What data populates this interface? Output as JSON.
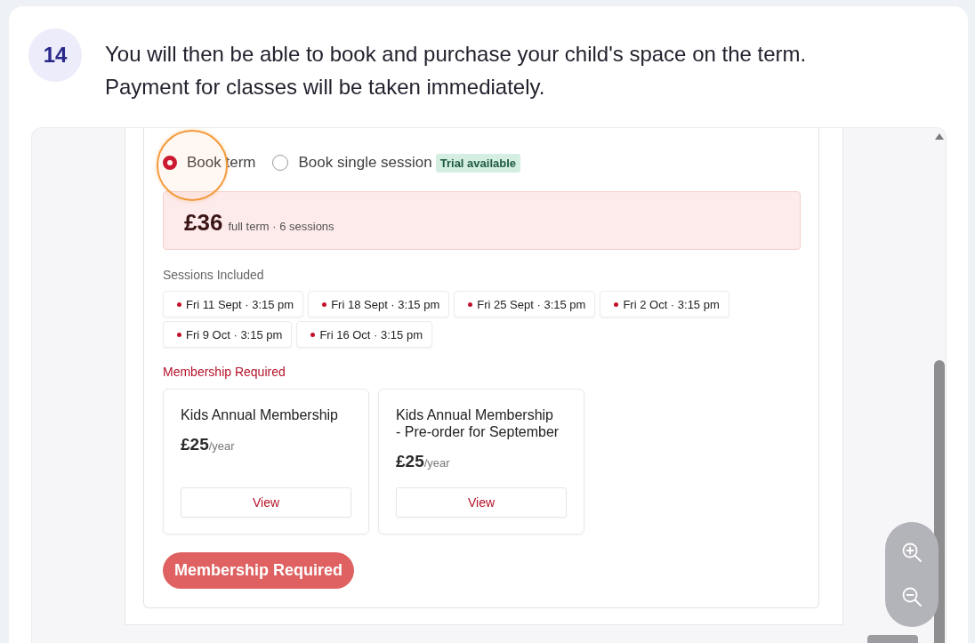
{
  "step": {
    "number": "14",
    "text": "You will then be able to book and purchase your child's space on the term. Payment for classes will be taken immediately."
  },
  "booking": {
    "options": [
      {
        "label": "Book term",
        "selected": true,
        "highlighted": true
      },
      {
        "label": "Book single session",
        "selected": false,
        "highlighted": false,
        "badge": "Trial available"
      }
    ],
    "price": {
      "amount": "£36",
      "detail": "full term · 6 sessions"
    },
    "sessions": {
      "label": "Sessions Included",
      "items": [
        "Fri 11 Sept · 3:15 pm",
        "Fri 18 Sept · 3:15 pm",
        "Fri 25 Sept · 3:15 pm",
        "Fri 2 Oct · 3:15 pm",
        "Fri 9 Oct · 3:15 pm",
        "Fri 16 Oct · 3:15 pm"
      ]
    },
    "membership": {
      "label": "Membership Required",
      "cards": [
        {
          "title": "Kids Annual Membership",
          "price": "£25",
          "period": "/year",
          "button": "View"
        },
        {
          "title": "Kids Annual Membership - Pre-order for September",
          "price": "£25",
          "period": "/year",
          "button": "View"
        }
      ]
    },
    "submit": {
      "label": "Membership Required",
      "disabled": true
    }
  }
}
